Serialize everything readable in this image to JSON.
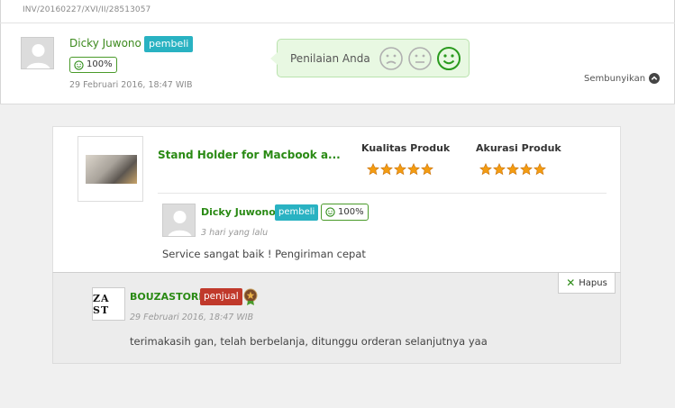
{
  "invoice_number": "INV/20160227/XVI/II/28513057",
  "buyer": {
    "name": "Dicky Juwono",
    "role_badge": "pembeli",
    "reputation": "100%",
    "date": "29 Februari 2016, 18:47 WIB"
  },
  "rating_prompt": {
    "label": "Penilaian Anda",
    "options": [
      "sad-face-icon",
      "neutral-face-icon",
      "happy-face-icon"
    ],
    "selected": "happy-face-icon",
    "selected_color": "#2a9a1e",
    "unselected_color": "#b0b0b0"
  },
  "hide_label": "Sembunyikan",
  "product": {
    "name": "Stand Holder for Macbook a...",
    "quality_label": "Kualitas Produk",
    "accuracy_label": "Akurasi Produk",
    "quality_stars": 5,
    "accuracy_stars": 5,
    "star_color": "#f39c12"
  },
  "review": {
    "reviewer_name": "Dicky Juwono",
    "role_badge": "pembeli",
    "reputation": "100%",
    "date": "3 hari yang lalu",
    "text": "Service sangat baik ! Pengiriman cepat"
  },
  "reply": {
    "delete_label": "Hapus",
    "seller_logo_text": "ZA ST",
    "seller_name": "BOUZASTORE",
    "role_badge": "penjual",
    "date": "29 Februari 2016, 18:47 WIB",
    "text": "terimakasih gan, telah berbelanja, ditunggu orderan selanjutnya yaa"
  }
}
